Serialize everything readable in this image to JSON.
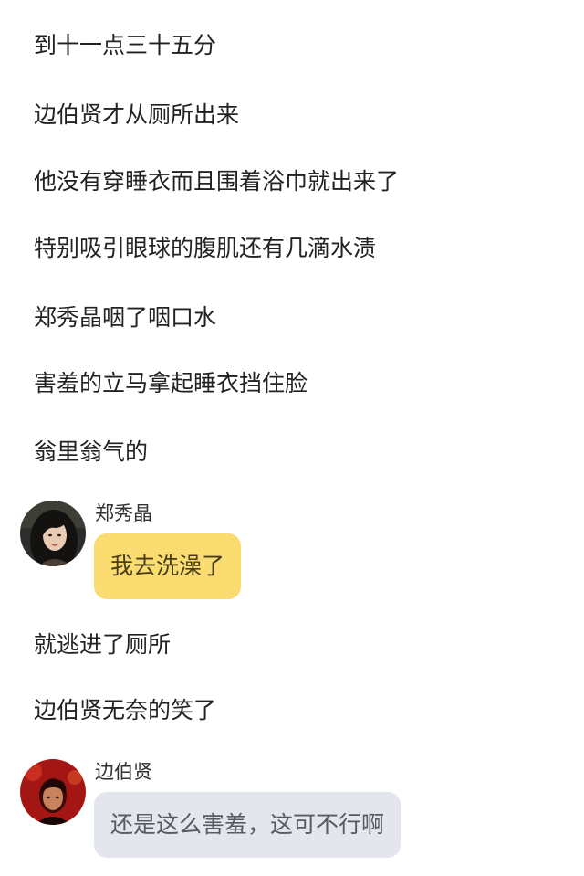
{
  "story": {
    "line1": "到十一点三十五分",
    "line2": "边伯贤才从厕所出来",
    "line3": "他没有穿睡衣而且围着浴巾就出来了",
    "line4": "特别吸引眼球的腹肌还有几滴水渍",
    "line5": "郑秀晶咽了咽口水",
    "line6": "害羞的立马拿起睡衣挡住脸",
    "line7": "翁里翁气的",
    "line8": "就逃进了厕所",
    "line9": "边伯贤无奈的笑了"
  },
  "messages": [
    {
      "sender": "郑秀晶",
      "text": "我去洗澡了",
      "bubble_color": "#fbdc71"
    },
    {
      "sender": "边伯贤",
      "text": "还是这么害羞，这可不行啊",
      "bubble_color": "#e3e6ec"
    }
  ],
  "icons": {
    "avatar1": "female-avatar-photo",
    "avatar2": "male-avatar-photo"
  }
}
